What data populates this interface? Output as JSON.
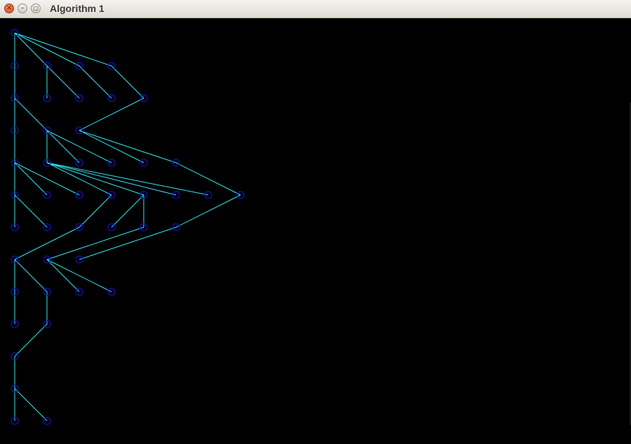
{
  "window": {
    "title": "Algorithm 1",
    "close_icon": "close-icon",
    "minimize_icon": "minimize-icon",
    "maximize_icon": "maximize-icon"
  },
  "graph": {
    "node_color": "#1010c0",
    "edge_color": "#33e6f0",
    "background": "#000000",
    "node_count": 47,
    "edge_count": 46
  }
}
